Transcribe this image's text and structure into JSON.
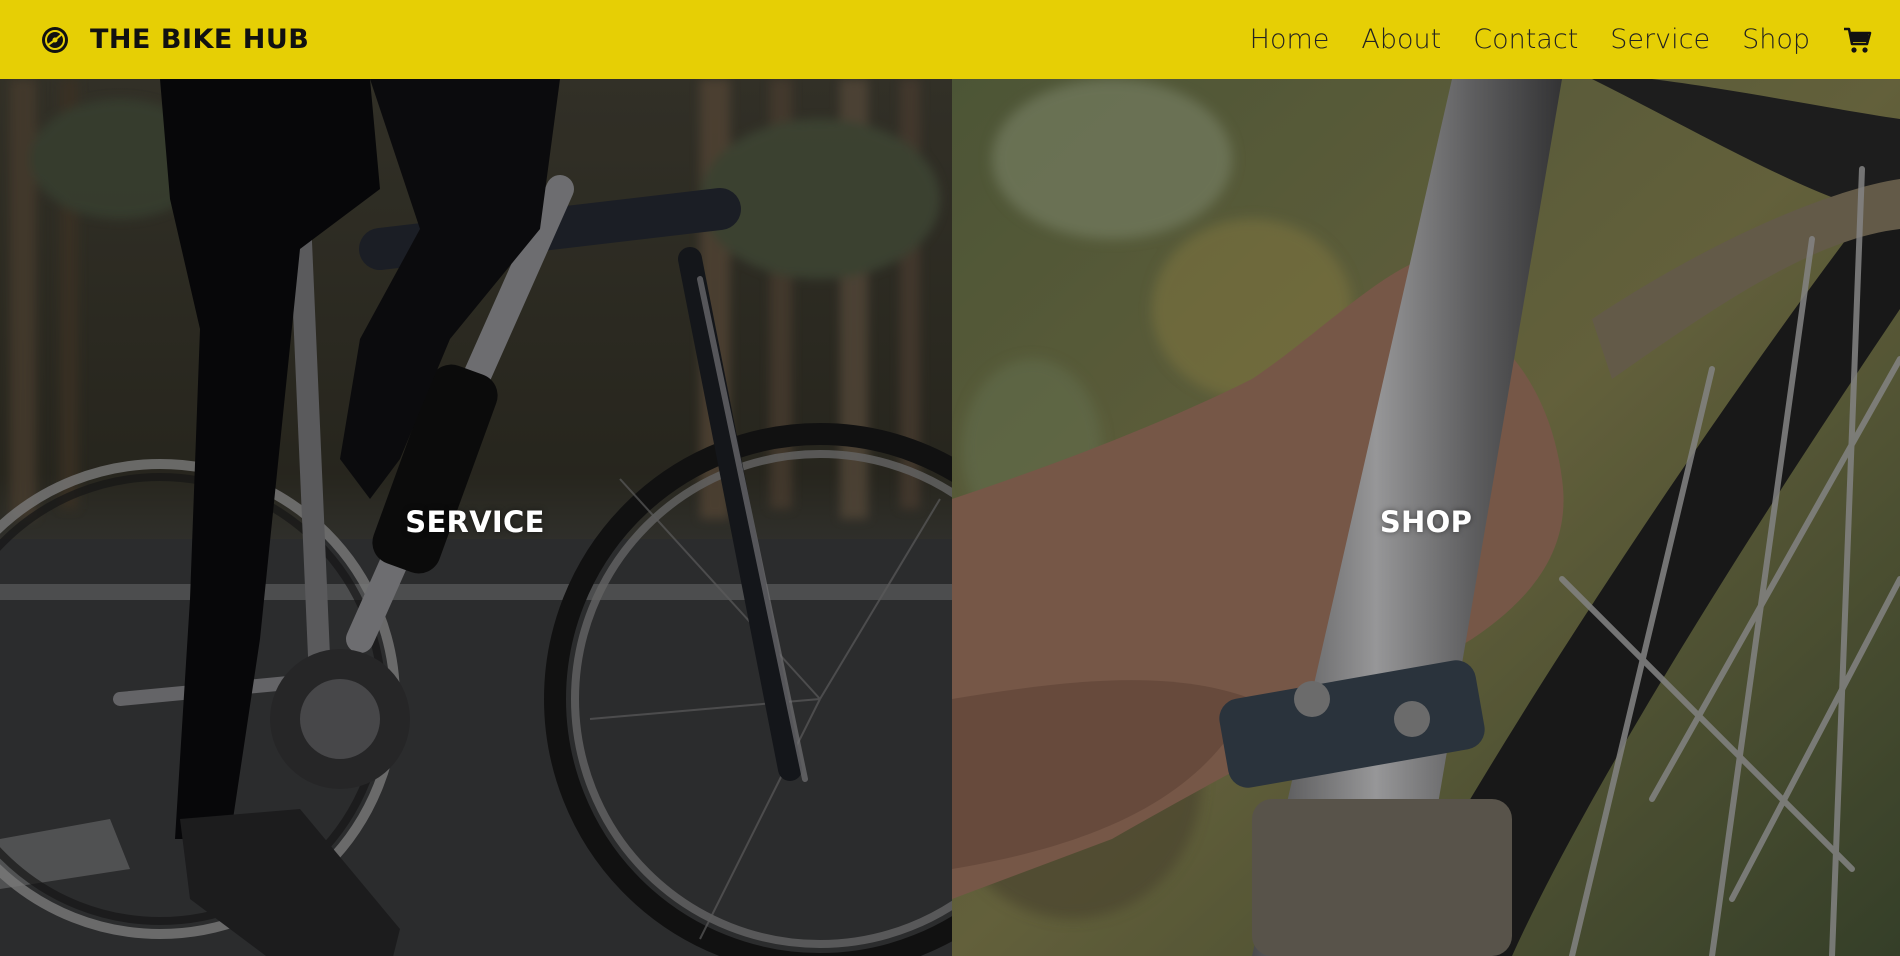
{
  "header": {
    "brand_name": "THE BIKE HUB",
    "brand_icon": "bicycle-wheel-icon",
    "nav": [
      "Home",
      "About",
      "Contact",
      "Service",
      "Shop"
    ],
    "cart_icon": "shopping-cart-icon"
  },
  "panels": {
    "service_label": "SERVICE",
    "shop_label": "SHOP"
  },
  "colors": {
    "nav_bg": "#e6cf05",
    "brand_text": "#111111",
    "panel_text": "#ffffff"
  }
}
